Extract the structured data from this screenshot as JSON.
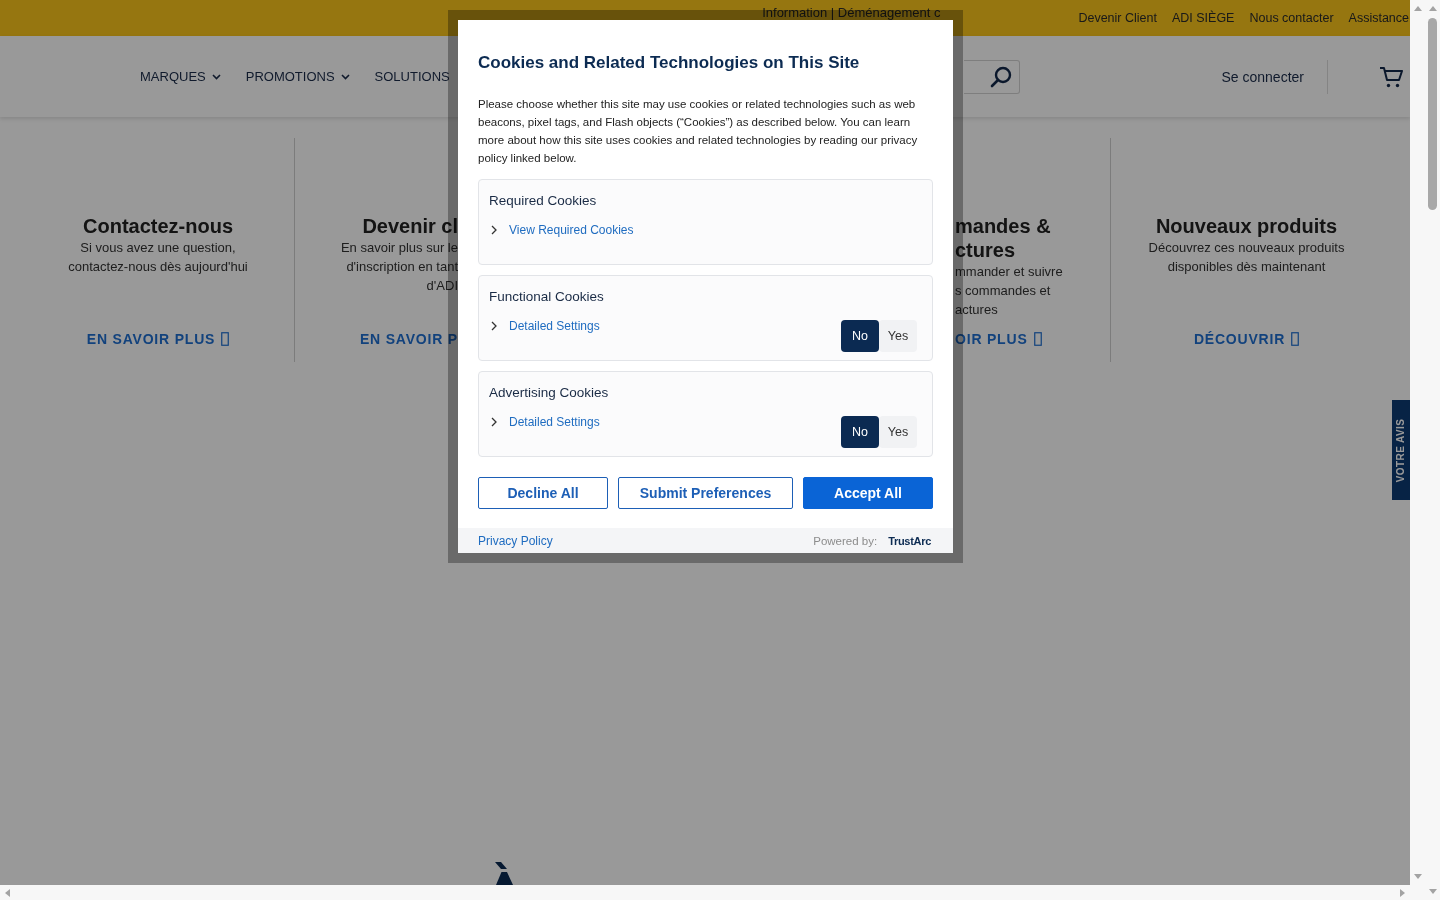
{
  "top_bar": {
    "notice": "Information | Déménagement c",
    "links": [
      "Devenir Client",
      "ADI SIÈGE",
      "Nous contacter",
      "Assistance"
    ]
  },
  "nav": {
    "menu": [
      {
        "label": "MARQUES",
        "dropdown": true
      },
      {
        "label": "PROMOTIONS",
        "dropdown": true
      },
      {
        "label": "SOLUTIONS",
        "dropdown": false
      }
    ],
    "sign_in": "Se connecter"
  },
  "cards": [
    {
      "title": "Contactez-nous",
      "description_lines": [
        "Si vous avez une question,",
        "contactez-nous dès aujourd'hui"
      ],
      "link": {
        "label": "EN SAVOIR PLUS",
        "glyph": true
      }
    },
    {
      "title": "Devenir cl",
      "description_lines": [
        "En savoir plus sur le",
        "d'inscription en tant",
        "d'ADI"
      ],
      "link": {
        "label": "EN SAVOIR P"
      }
    },
    {
      "title": "mandes & ctures",
      "description_lines": [
        "mmander et suivre",
        "s commandes et",
        "actures"
      ],
      "link": {
        "label": "OIR PLUS",
        "glyph": true
      }
    },
    {
      "title": "Nouveaux produits",
      "description_lines": [
        "Découvrez ces nouveaux produits",
        "disponibles dès maintenant"
      ],
      "link": {
        "label": "DÉCOUVRIR",
        "glyph": true
      }
    }
  ],
  "feedback_tab": {
    "label": "VOTRE AVIS"
  },
  "cookie_dialog": {
    "title": "Cookies and Related Technologies on This Site",
    "intro": "Please choose whether this site may use cookies or related technologies such as web beacons, pixel tags, and Flash objects (“Cookies”) as described below. You can learn more about how this site uses cookies and related technologies by reading our privacy policy linked below.",
    "sections": [
      {
        "title": "Required Cookies",
        "link": "View Required Cookies"
      },
      {
        "title": "Functional Cookies",
        "link": "Detailed Settings",
        "options": [
          {
            "label": "No",
            "selected": true
          },
          {
            "label": "Yes",
            "selected": false
          }
        ]
      },
      {
        "title": "Advertising Cookies",
        "link": "Detailed Settings",
        "options": [
          {
            "label": "No",
            "selected": true
          },
          {
            "label": "Yes",
            "selected": false
          }
        ]
      }
    ],
    "buttons": [
      {
        "label": "Decline All",
        "kind": "secondary"
      },
      {
        "label": "Submit Preferences",
        "kind": "secondary"
      },
      {
        "label": "Accept All",
        "kind": "primary"
      }
    ],
    "footer": {
      "privacy_link": "Privacy Policy",
      "powered_by": "Powered by:",
      "provider": "TrustArc"
    }
  }
}
